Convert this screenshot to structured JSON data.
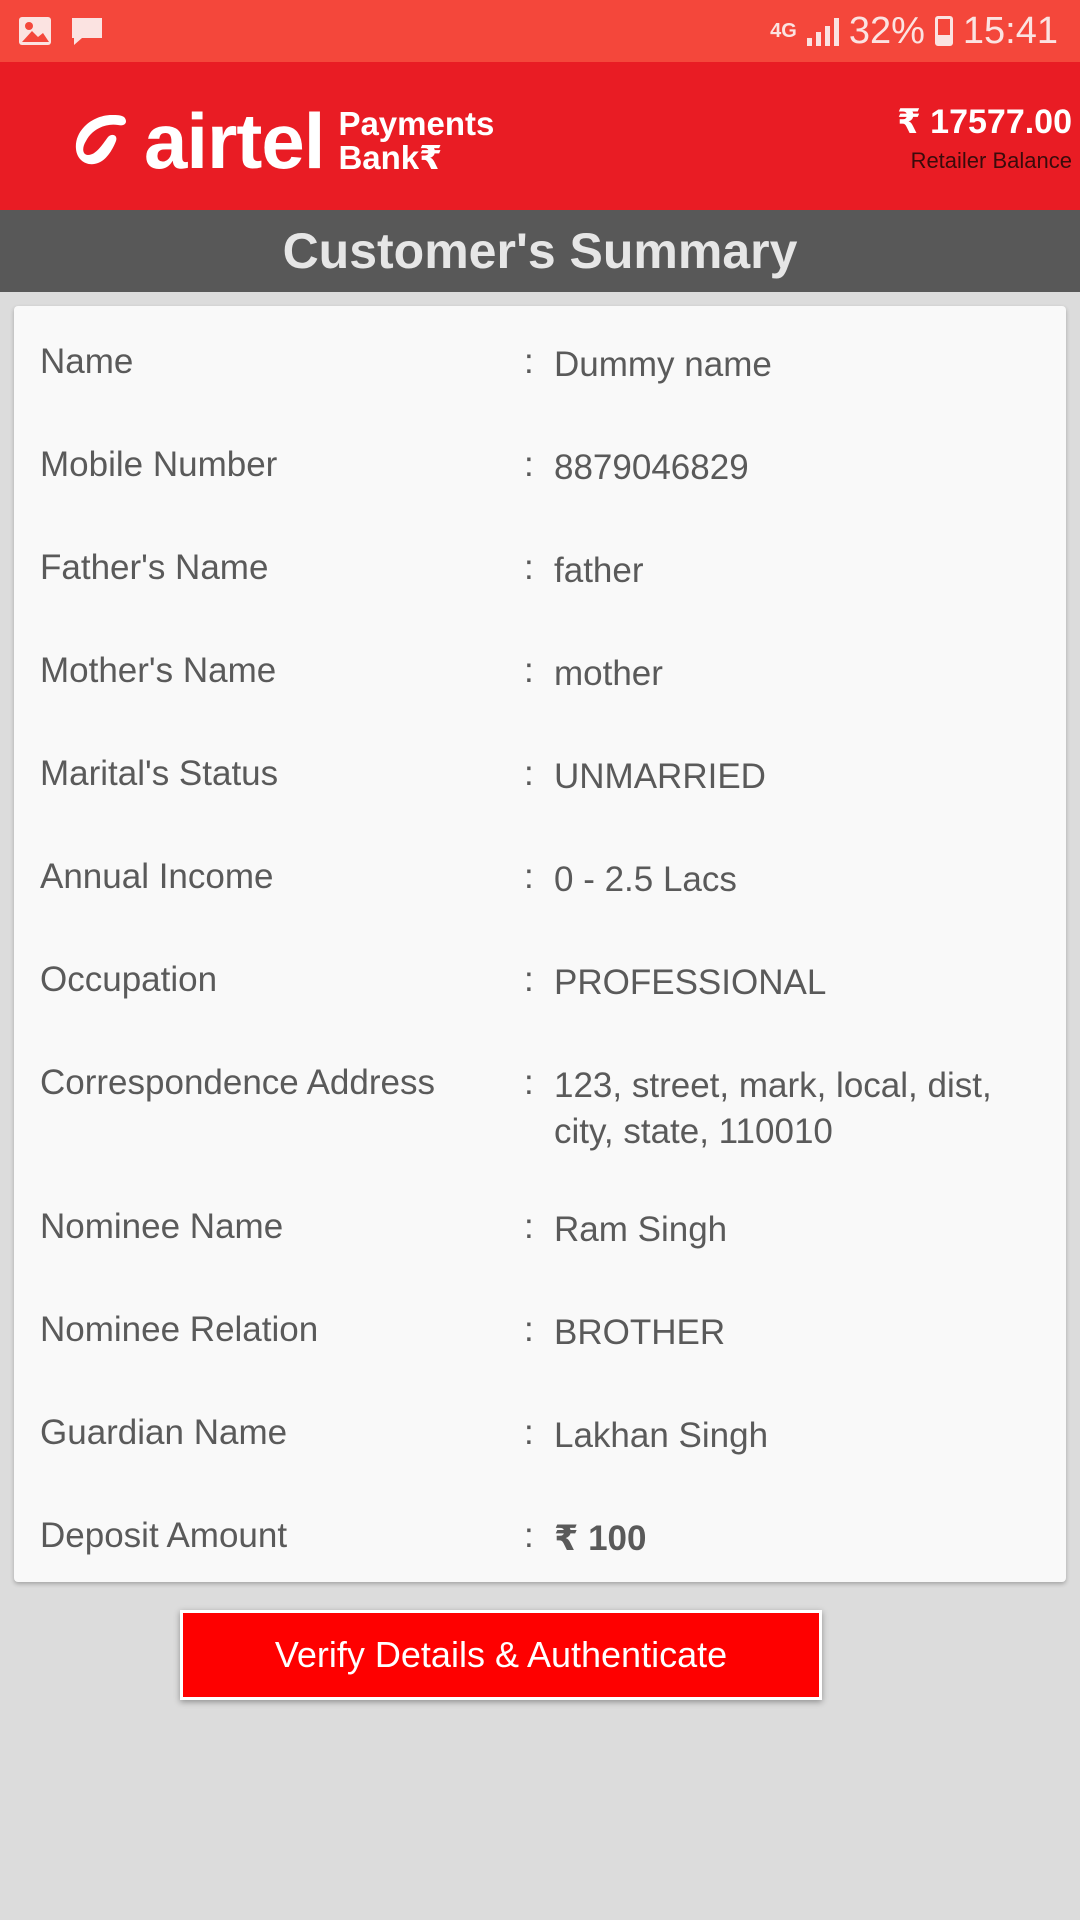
{
  "status_bar": {
    "network": "4G",
    "battery": "32%",
    "time": "15:41",
    "icons": [
      "gallery-icon",
      "message-icon",
      "signal-icon",
      "battery-icon"
    ]
  },
  "header": {
    "brand": "airtel",
    "brand_sub_line1": "Payments",
    "brand_sub_line2": "Bank₹",
    "balance_amount": "₹ 17577.00",
    "balance_label": "Retailer Balance"
  },
  "title": "Customer's Summary",
  "summary": [
    {
      "label": "Name",
      "value": "Dummy name"
    },
    {
      "label": "Mobile Number",
      "value": "8879046829"
    },
    {
      "label": "Father's Name",
      "value": "father"
    },
    {
      "label": "Mother's Name",
      "value": "mother"
    },
    {
      "label": "Marital's Status",
      "value": "UNMARRIED"
    },
    {
      "label": "Annual Income",
      "value": "0 - 2.5 Lacs"
    },
    {
      "label": "Occupation",
      "value": "PROFESSIONAL"
    },
    {
      "label": "Correspondence Address",
      "value": "123, street, mark, local, dist, city, state, 110010"
    },
    {
      "label": "Nominee Name",
      "value": "Ram Singh"
    },
    {
      "label": "Nominee Relation",
      "value": "BROTHER"
    },
    {
      "label": "Guardian Name",
      "value": "Lakhan Singh"
    },
    {
      "label": "Deposit Amount",
      "value": "₹ 100"
    }
  ],
  "separator": ":",
  "verify_button": "Verify Details & Authenticate",
  "colors": {
    "status_bar": "#f4473b",
    "header": "#e91c24",
    "title_bar": "#585858",
    "button": "#fe0000"
  }
}
